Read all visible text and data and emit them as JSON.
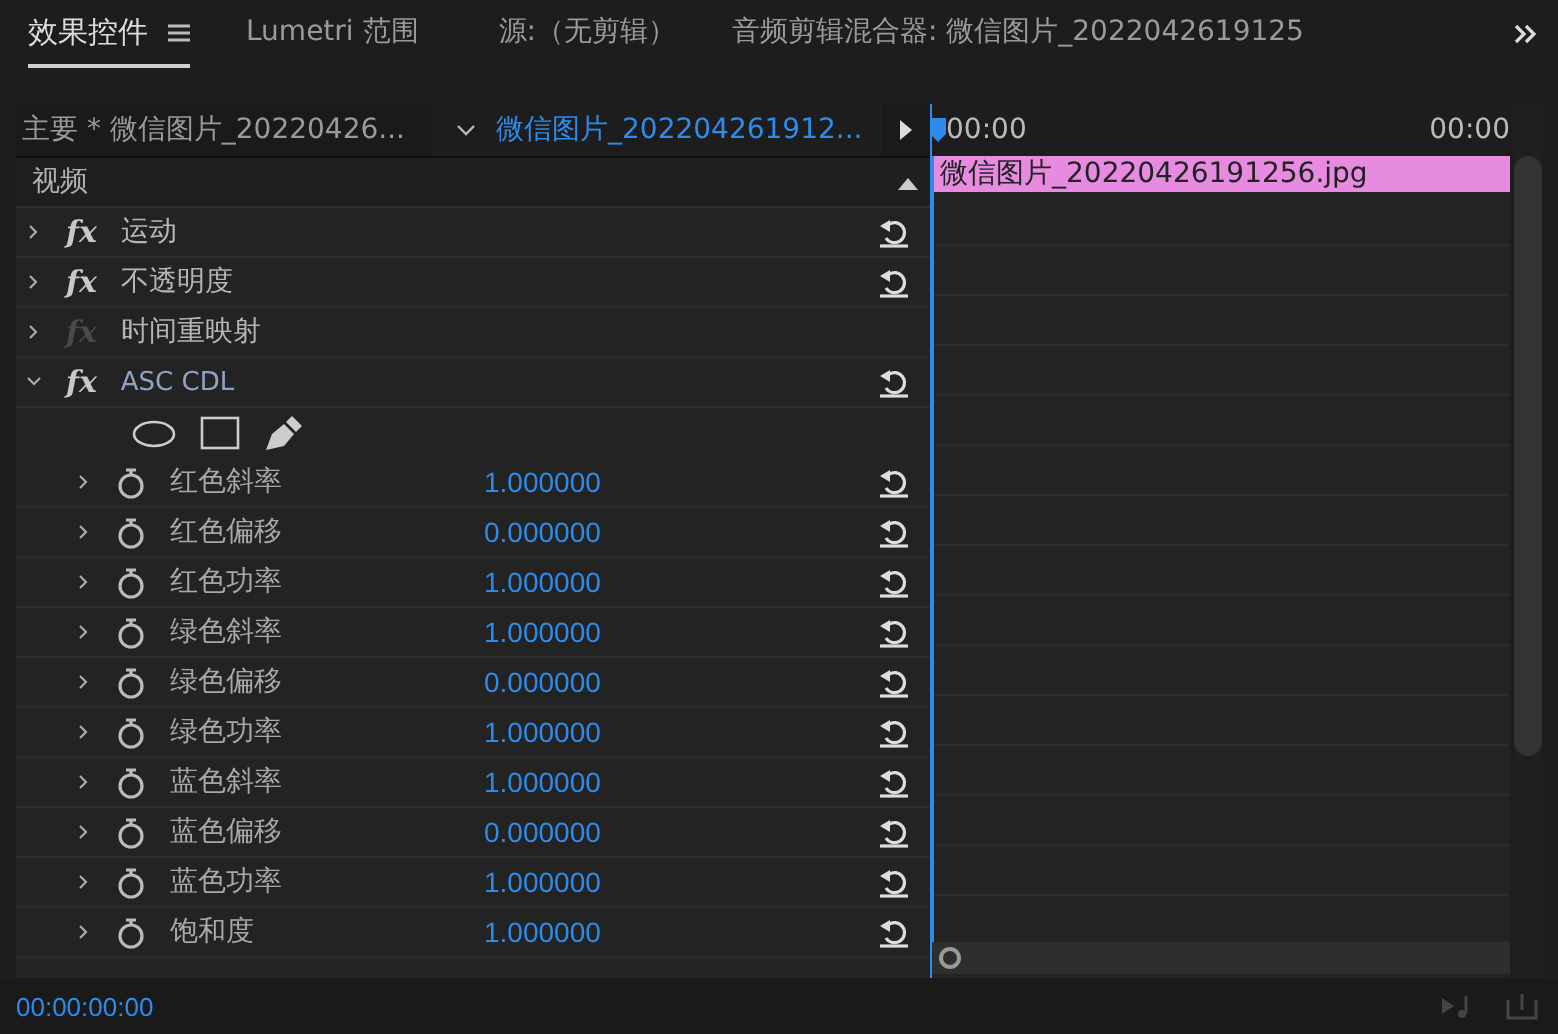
{
  "tabs": [
    {
      "label": "效果控件",
      "selected": true,
      "has_menu": true
    },
    {
      "label": "Lumetri 范围",
      "selected": false,
      "has_menu": false
    },
    {
      "label": "源:（无剪辑）",
      "selected": false,
      "has_menu": false
    },
    {
      "label": "音频剪辑混合器: 微信图片_2022042619125",
      "selected": false,
      "has_menu": false
    }
  ],
  "clip_bar": {
    "master": "主要 * 微信图片_20220426...",
    "clip": "微信图片_202204261912..."
  },
  "timeline": {
    "ruler_start": "00:00",
    "ruler_end": "00:00",
    "clip_label": "微信图片_20220426191256.jpg"
  },
  "section": {
    "label": "视频",
    "expanded": true
  },
  "effects": [
    {
      "name": "运动",
      "fx": "fx",
      "fx_enabled": true,
      "expanded": false,
      "resettable": true,
      "selected": false
    },
    {
      "name": "不透明度",
      "fx": "fx",
      "fx_enabled": true,
      "expanded": false,
      "resettable": true,
      "selected": false
    },
    {
      "name": "时间重映射",
      "fx": "fx",
      "fx_enabled": false,
      "expanded": false,
      "resettable": false,
      "selected": false
    },
    {
      "name": "ASC CDL",
      "fx": "fx",
      "fx_enabled": true,
      "expanded": true,
      "resettable": true,
      "selected": true,
      "mask_tools": true,
      "children": [
        {
          "name": "红色斜率",
          "value": "1.000000"
        },
        {
          "name": "红色偏移",
          "value": "0.000000"
        },
        {
          "name": "红色功率",
          "value": "1.000000"
        },
        {
          "name": "绿色斜率",
          "value": "1.000000"
        },
        {
          "name": "绿色偏移",
          "value": "0.000000"
        },
        {
          "name": "绿色功率",
          "value": "1.000000"
        },
        {
          "name": "蓝色斜率",
          "value": "1.000000"
        },
        {
          "name": "蓝色偏移",
          "value": "0.000000"
        },
        {
          "name": "蓝色功率",
          "value": "1.000000"
        },
        {
          "name": "饱和度",
          "value": "1.000000"
        }
      ]
    }
  ],
  "status": {
    "timecode": "00:00:00:00"
  }
}
